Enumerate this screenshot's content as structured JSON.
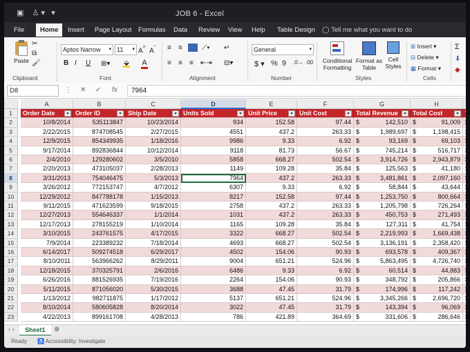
{
  "window": {
    "title": "JOB 6  -  Excel"
  },
  "tabs": [
    "File",
    "Home",
    "Insert",
    "Page Layout",
    "Formulas",
    "Data",
    "Review",
    "View",
    "Help",
    "Table Design"
  ],
  "active_tab": "Home",
  "tell_me": "Tell me what you want to do",
  "ribbon": {
    "paste": "Paste",
    "clipboard": "Clipboard",
    "font_name": "Aptos Narrow",
    "font_size": "11",
    "font_group": "Font",
    "bold": "B",
    "italic": "I",
    "underline": "U",
    "alignment_group": "Alignment",
    "number_format": "General",
    "currency": "$",
    "percent": "%",
    "comma": "9",
    "number_group": "Number",
    "conditional_formatting": "Conditional Formatting",
    "format_as_table": "Format as Table",
    "cell_styles": "Cell Styles",
    "styles_group": "Styles",
    "insert": "Insert",
    "delete": "Delete",
    "format": "Format",
    "cells_group": "Cells"
  },
  "formula_bar": {
    "name_box": "D8",
    "fx": "fx",
    "content": "7964"
  },
  "columns": [
    "A",
    "B",
    "C",
    "D",
    "E",
    "F",
    "G",
    "H"
  ],
  "headers": [
    "Order Date",
    "Order ID",
    "Ship Date",
    "Units Sold",
    "Unit Price",
    "Unit Cost",
    "Total Revenue",
    "Total Cost",
    "To"
  ],
  "rows": [
    {
      "n": "2",
      "c": [
        "10/8/2014",
        "535113847",
        "10/23/2014",
        "934",
        "152.58",
        "97.44",
        "142,510",
        "91,009"
      ]
    },
    {
      "n": "3",
      "c": [
        "2/22/2015",
        "874708545",
        "2/27/2015",
        "4551",
        "437.2",
        "263.33",
        "1,989,697",
        "1,198,415"
      ]
    },
    {
      "n": "4",
      "c": [
        "12/9/2015",
        "854349935",
        "1/18/2016",
        "9986",
        "9.33",
        "6.92",
        "93,169",
        "69,103"
      ]
    },
    {
      "n": "5",
      "c": [
        "9/17/2014",
        "892836844",
        "10/12/2014",
        "9118",
        "81.73",
        "56.67",
        "745,214",
        "516,717"
      ]
    },
    {
      "n": "6",
      "c": [
        "2/4/2010",
        "129280602",
        "3/5/2010",
        "5858",
        "668.27",
        "502.54",
        "3,914,726",
        "2,943,879"
      ]
    },
    {
      "n": "7",
      "c": [
        "2/20/2013",
        "473105037",
        "2/28/2013",
        "1149",
        "109.28",
        "35.84",
        "125,563",
        "41,180"
      ]
    },
    {
      "n": "8",
      "c": [
        "3/31/2013",
        "754046475",
        "5/3/2013",
        "7964",
        "437.2",
        "263.33",
        "3,481,861",
        "2,097,160"
      ]
    },
    {
      "n": "9",
      "c": [
        "3/26/2012",
        "772153747",
        "4/7/2012",
        "6307",
        "9.33",
        "6.92",
        "58,844",
        "43,644"
      ]
    },
    {
      "n": "10",
      "c": [
        "12/29/2012",
        "847788178",
        "1/15/2013",
        "8217",
        "152.58",
        "97.44",
        "1,253,750",
        "800,664"
      ]
    },
    {
      "n": "11",
      "c": [
        "9/11/2015",
        "471623599",
        "9/18/2015",
        "2758",
        "437.2",
        "263.33",
        "1,205,798",
        "726,264"
      ]
    },
    {
      "n": "12",
      "c": [
        "12/27/2013",
        "554646337",
        "1/1/2014",
        "1031",
        "437.2",
        "263.33",
        "450,753",
        "271,493"
      ]
    },
    {
      "n": "13",
      "c": [
        "12/17/2013",
        "278155219",
        "1/10/2014",
        "1165",
        "109.28",
        "35.84",
        "127,311",
        "41,754"
      ]
    },
    {
      "n": "14",
      "c": [
        "3/10/2015",
        "243761575",
        "4/17/2015",
        "3322",
        "668.27",
        "502.54",
        "2,219,993",
        "1,669,438"
      ]
    },
    {
      "n": "15",
      "c": [
        "7/9/2014",
        "223389232",
        "7/18/2014",
        "4693",
        "668.27",
        "502.54",
        "3,136,191",
        "2,358,420"
      ]
    },
    {
      "n": "16",
      "c": [
        "6/14/2017",
        "509274518",
        "6/29/2017",
        "4502",
        "154.06",
        "90.93",
        "693,578",
        "409,367"
      ]
    },
    {
      "n": "17",
      "c": [
        "8/10/2011",
        "563966262",
        "8/29/2011",
        "9004",
        "651.21",
        "524.96",
        "5,863,495",
        "4,726,740"
      ]
    },
    {
      "n": "18",
      "c": [
        "12/18/2015",
        "370325791",
        "2/6/2016",
        "6486",
        "9.33",
        "6.92",
        "60,514",
        "44,883"
      ]
    },
    {
      "n": "19",
      "c": [
        "6/26/2016",
        "881526935",
        "7/19/2016",
        "2264",
        "154.06",
        "90.93",
        "348,792",
        "205,866"
      ]
    },
    {
      "n": "20",
      "c": [
        "5/11/2015",
        "871056020",
        "5/30/2015",
        "3688",
        "47.45",
        "31.79",
        "174,996",
        "117,242"
      ]
    },
    {
      "n": "21",
      "c": [
        "1/13/2012",
        "982711875",
        "1/17/2012",
        "5137",
        "651.21",
        "524.96",
        "3,345,266",
        "2,696,720"
      ]
    },
    {
      "n": "22",
      "c": [
        "8/10/2014",
        "580605828",
        "8/20/2014",
        "3022",
        "47.45",
        "31.79",
        "143,394",
        "96,069"
      ]
    },
    {
      "n": "23",
      "c": [
        "4/22/2013",
        "899161708",
        "4/28/2013",
        "786",
        "421.89",
        "364.69",
        "331,606",
        "286,646"
      ]
    }
  ],
  "currency_symbol": "$",
  "sheet_tab": "Sheet1",
  "status": {
    "ready": "Ready",
    "accessibility": "Accessibility: Investigate"
  },
  "colors": {
    "header_red": "#c3252a",
    "row_pink": "#f3dada",
    "row_white": "#ffffff",
    "accent_green": "#1e6b3c"
  }
}
